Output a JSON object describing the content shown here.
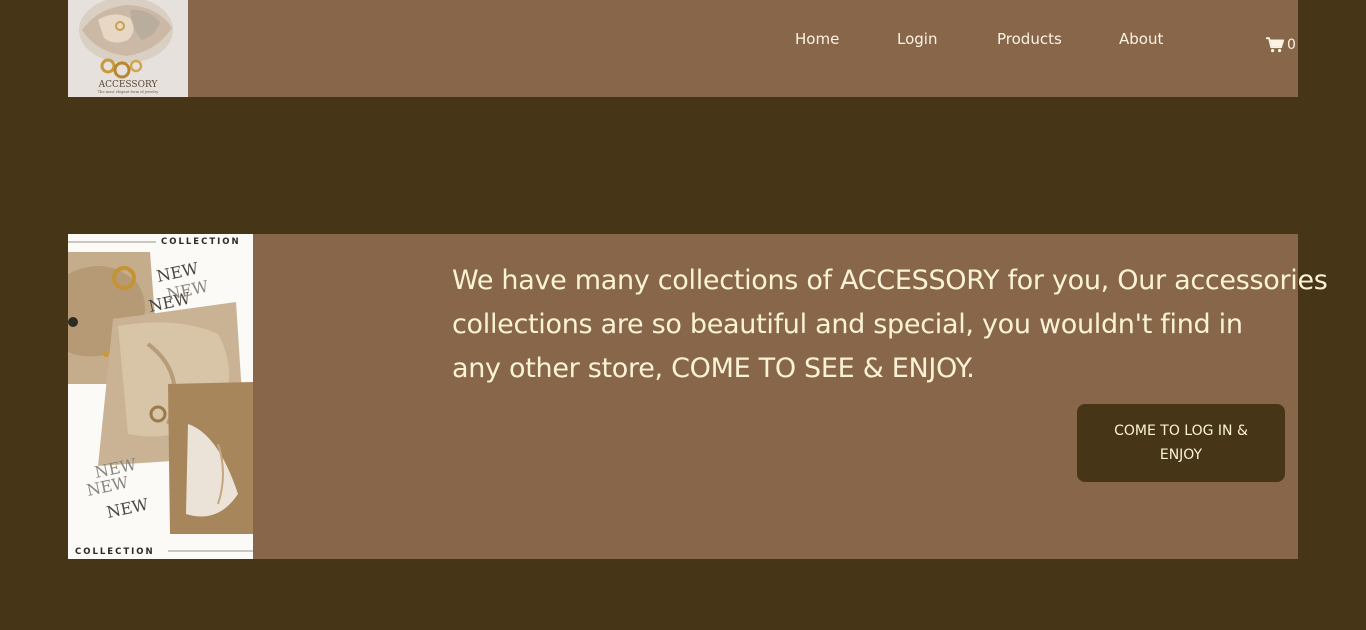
{
  "nav": {
    "logo_text": "ACCESSORY",
    "logo_tagline": "The most elegant form of jewelry",
    "links": [
      {
        "label": "Home"
      },
      {
        "label": "Login"
      },
      {
        "label": "Products"
      },
      {
        "label": "About"
      }
    ],
    "cart_count": "0",
    "cart_icon": "shopping-cart-icon"
  },
  "hero": {
    "image_label_top": "COLLECTION",
    "image_label_bottom": "COLLECTION",
    "lines": [
      "We have many collections of ACCESSORY for you, Our accessories",
      "collections are so beautiful and special, you wouldn't find in",
      "any other store, COME TO SEE & ENJOY."
    ],
    "cta_label": "COME TO LOG IN & ENJOY"
  },
  "colors": {
    "page_background": "#473518",
    "panel_background": "#88664a",
    "text": "#fbf3d6",
    "button_background": "#473518"
  }
}
